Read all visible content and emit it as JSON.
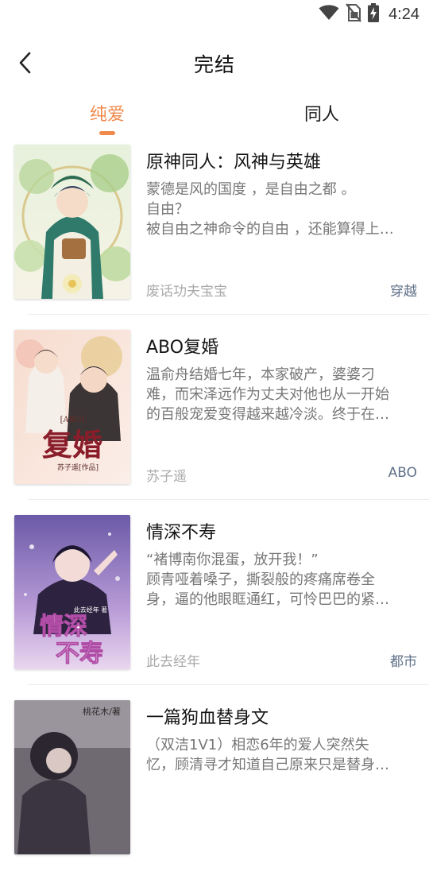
{
  "status_bar": {
    "time": "4:24",
    "icons": [
      "wifi-icon",
      "no-sim-icon",
      "battery-charging-icon"
    ]
  },
  "header": {
    "back_icon": "chevron-left-icon",
    "title": "完结"
  },
  "tabs": [
    {
      "label": "纯爱",
      "active": true
    },
    {
      "label": "同人",
      "active": false
    }
  ],
  "colors": {
    "accent": "#f08a4b",
    "tag": "#5f7089",
    "author": "#a9a9a9",
    "description": "#777777"
  },
  "books": [
    {
      "title": "原神同人：风神与英雄",
      "description": [
        "蒙德是风的国度 ，是自由之都 。",
        "自由？",
        "被自由之神命令的自由 ，还能算得上…"
      ],
      "author": "废话功夫宝宝",
      "tag": "穿越"
    },
    {
      "title": "ABO复婚",
      "description": [
        "温俞舟结婚七年，本家破产，婆婆刁",
        "难，而宋泽远作为丈夫对他也从一开始",
        "的百般宠爱变得越来越冷淡。终于在…"
      ],
      "author": "苏子遥",
      "tag": "ABO",
      "cover_text": {
        "top": "[ABO]",
        "main": "复婚",
        "sub": "苏子遥[作品]"
      }
    },
    {
      "title": "情深不寿",
      "description": [
        "“褚博南你混蛋，放开我！”",
        "顾青哑着嗓子，撕裂般的疼痛席卷全",
        "身，逼的他眼眶通红，可怜巴巴的紧…"
      ],
      "author": "此去经年",
      "tag": "都市",
      "cover_text": {
        "top": "此去经年 著",
        "main1": "情深",
        "main2": "不寿"
      }
    },
    {
      "title": "一篇狗血替身文",
      "description": [
        "（双洁1V1）相恋6年的爱人突然失",
        "忆，顾清寻才知道自己原来只是替身…"
      ],
      "author": "",
      "tag": "",
      "cover_text": {
        "top": "桃花木/著"
      }
    }
  ]
}
